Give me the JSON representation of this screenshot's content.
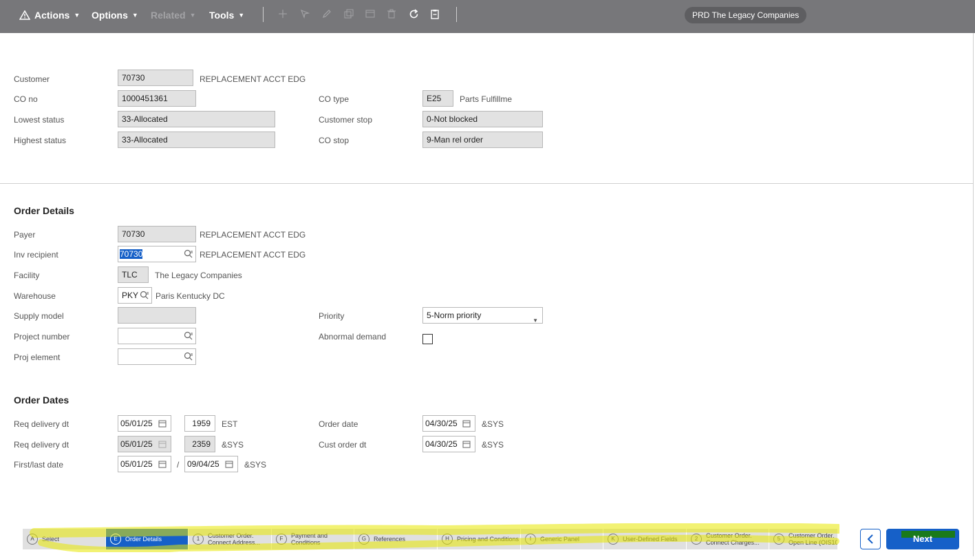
{
  "toolbar": {
    "menus": [
      "Actions",
      "Options",
      "Related",
      "Tools"
    ],
    "tenant": "PRD The Legacy Companies"
  },
  "header": {
    "customer": {
      "label": "Customer",
      "value": "70730",
      "desc": "REPLACEMENT ACCT EDG"
    },
    "co_no": {
      "label": "CO no",
      "value": "1000451361"
    },
    "lowest_status": {
      "label": "Lowest status",
      "value": "33-Allocated"
    },
    "highest_status": {
      "label": "Highest status",
      "value": "33-Allocated"
    },
    "co_type": {
      "label": "CO type",
      "value": "E25",
      "desc": "Parts Fulfillme"
    },
    "customer_stop": {
      "label": "Customer stop",
      "value": "0-Not blocked"
    },
    "co_stop": {
      "label": "CO stop",
      "value": "9-Man rel order"
    }
  },
  "order_details": {
    "title": "Order Details",
    "payer": {
      "label": "Payer",
      "value": "70730",
      "desc": "REPLACEMENT ACCT EDG"
    },
    "inv_recipient": {
      "label": "Inv recipient",
      "value": "70730",
      "desc": "REPLACEMENT ACCT EDG"
    },
    "facility": {
      "label": "Facility",
      "value": "TLC",
      "desc": "The Legacy Companies"
    },
    "warehouse": {
      "label": "Warehouse",
      "value": "PKY",
      "desc": "Paris Kentucky DC"
    },
    "supply_model": {
      "label": "Supply model",
      "value": ""
    },
    "project_number": {
      "label": "Project number",
      "value": ""
    },
    "proj_element": {
      "label": "Proj element",
      "value": ""
    },
    "priority": {
      "label": "Priority",
      "value": "5-Norm priority"
    },
    "abnormal_demand": {
      "label": "Abnormal demand",
      "checked": false
    }
  },
  "order_dates": {
    "title": "Order Dates",
    "req_delivery_1": {
      "label": "Req delivery dt",
      "date": "05/01/25",
      "time": "1959",
      "tz": "EST"
    },
    "req_delivery_2": {
      "label": "Req delivery dt",
      "date": "05/01/25",
      "time": "2359",
      "tz": "&SYS"
    },
    "first_last": {
      "label": "First/last date",
      "first": "05/01/25",
      "separator": "/",
      "last": "09/04/25",
      "tz": "&SYS"
    },
    "order_date": {
      "label": "Order date",
      "date": "04/30/25",
      "tz": "&SYS"
    },
    "cust_order_dt": {
      "label": "Cust order dt",
      "date": "04/30/25",
      "tz": "&SYS"
    }
  },
  "steps": [
    {
      "key": "A",
      "line1": "Select",
      "line2": ""
    },
    {
      "key": "E",
      "line1": "Order Details",
      "line2": ""
    },
    {
      "key": "1",
      "line1": "Customer Order.",
      "line2": "Connect Address..."
    },
    {
      "key": "F",
      "line1": "Payment and",
      "line2": "Conditions"
    },
    {
      "key": "G",
      "line1": "References",
      "line2": ""
    },
    {
      "key": "H",
      "line1": "Pricing and Conditions",
      "line2": ""
    },
    {
      "key": "I",
      "line1": "Generic Panel",
      "line2": ""
    },
    {
      "key": "K",
      "line1": "User-Defined Fields",
      "line2": ""
    },
    {
      "key": "2",
      "line1": "Customer Order.",
      "line2": "Connect Charges..."
    },
    {
      "key": "5",
      "line1": "Customer Order.",
      "line2": "Open Line (OIS10"
    }
  ],
  "nav": {
    "next_label": "Next",
    "back_icon": "chevron-left-icon"
  },
  "colors": {
    "accent": "#1660c8",
    "toolbar": "#77777a",
    "highlight": "#e8e800"
  }
}
